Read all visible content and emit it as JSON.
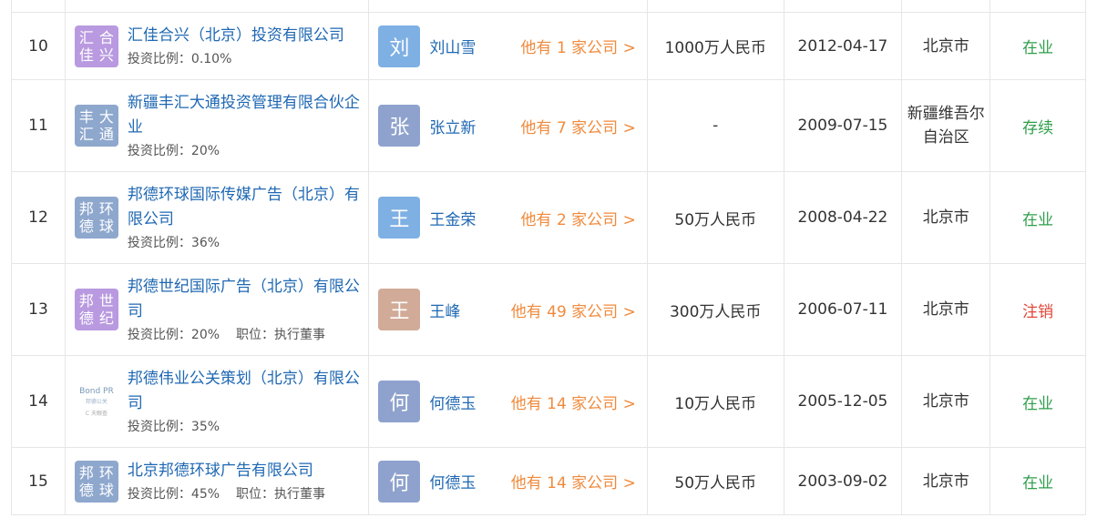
{
  "rows": [
    {
      "index": "10",
      "logo_lines": [
        "汇佳",
        "合兴"
      ],
      "logo_color": "#b99ae0",
      "company_name": "汇佳合兴（北京）投资有限公司",
      "ratio": "投资比例：0.10%",
      "position": "",
      "avatar_char": "刘",
      "avatar_color": "#7fb0e3",
      "person": "刘山雪",
      "others": "他有 1 家公司 >",
      "capital": "1000万人民币",
      "date": "2012-04-17",
      "region": "北京市",
      "status": "在业",
      "status_color": "#2e9e4a"
    },
    {
      "index": "11",
      "logo_lines": [
        "丰汇",
        "大通"
      ],
      "logo_color": "#8ea7cd",
      "company_name": "新疆丰汇大通投资管理有限合伙企业",
      "ratio": "投资比例：20%",
      "position": "",
      "avatar_char": "张",
      "avatar_color": "#8ea2cd",
      "person": "张立新",
      "others": "他有 7 家公司 >",
      "capital": "-",
      "date": "2009-07-15",
      "region": "新疆维吾尔自治区",
      "status": "存续",
      "status_color": "#2e9e4a"
    },
    {
      "index": "12",
      "logo_lines": [
        "邦德",
        "环球"
      ],
      "logo_color": "#8ea7cd",
      "company_name": "邦德环球国际传媒广告（北京）有限公司",
      "ratio": "投资比例：36%",
      "position": "",
      "avatar_char": "王",
      "avatar_color": "#7fb0e3",
      "person": "王金荣",
      "others": "他有 2 家公司 >",
      "capital": "50万人民币",
      "date": "2008-04-22",
      "region": "北京市",
      "status": "在业",
      "status_color": "#2e9e4a"
    },
    {
      "index": "13",
      "logo_lines": [
        "邦德",
        "世纪"
      ],
      "logo_color": "#b99ae0",
      "company_name": "邦德世纪国际广告（北京）有限公司",
      "ratio": "投资比例：20%",
      "position": "职位：执行董事",
      "avatar_char": "王",
      "avatar_color": "#d1ab98",
      "person": "王峰",
      "others": "他有 49 家公司 >",
      "capital": "300万人民币",
      "date": "2006-07-11",
      "region": "北京市",
      "status": "注销",
      "status_color": "#e0473a"
    },
    {
      "index": "14",
      "logo_lines": [],
      "logo_image": {
        "brand": "Bond PR",
        "sub": "邦德公关",
        "mark": "C 天眼查"
      },
      "logo_color": "",
      "company_name": "邦德伟业公关策划（北京）有限公司",
      "ratio": "投资比例：35%",
      "position": "",
      "avatar_char": "何",
      "avatar_color": "#8ea2cd",
      "person": "何德玉",
      "others": "他有 14 家公司 >",
      "capital": "10万人民币",
      "date": "2005-12-05",
      "region": "北京市",
      "status": "在业",
      "status_color": "#2e9e4a"
    },
    {
      "index": "15",
      "logo_lines": [
        "邦德",
        "环球"
      ],
      "logo_color": "#8ea7cd",
      "company_name": "北京邦德环球广告有限公司",
      "ratio": "投资比例：45%",
      "position": "职位：执行董事",
      "avatar_char": "何",
      "avatar_color": "#8ea2cd",
      "person": "何德玉",
      "others": "他有 14 家公司 >",
      "capital": "50万人民币",
      "date": "2003-09-02",
      "region": "北京市",
      "status": "在业",
      "status_color": "#2e9e4a"
    }
  ]
}
